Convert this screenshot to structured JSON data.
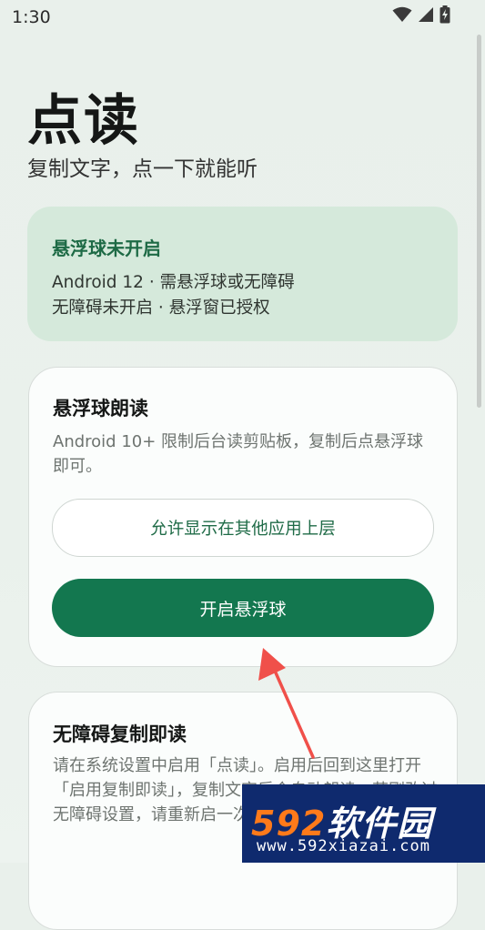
{
  "status_bar": {
    "time": "1:30"
  },
  "header": {
    "title": "点读",
    "subtitle": "复制文字，点一下就能听"
  },
  "status_card": {
    "title": "悬浮球未开启",
    "line1": "Android 12 · 需悬浮球或无障碍",
    "line2": "无障碍未开启 · 悬浮窗已授权"
  },
  "float_card": {
    "title": "悬浮球朗读",
    "description": "Android 10+ 限制后台读剪贴板，复制后点悬浮球即可。",
    "overlay_button": "允许显示在其他应用上层",
    "enable_button": "开启悬浮球"
  },
  "a11y_card": {
    "title": "无障碍复制即读",
    "description": "请在系统设置中启用「点读」。启用后回到这里打开「启用复制即读」，复制文字后会自动朗读。若刚改过无障碍设置，请重新启一次。"
  },
  "watermark": {
    "logo_num": "592",
    "logo_text": "软件园",
    "url": "www.592xiazai.com"
  },
  "colors": {
    "accent": "#13774f",
    "status_card_bg": "#d5e9db",
    "arrow": "#f0504a"
  }
}
